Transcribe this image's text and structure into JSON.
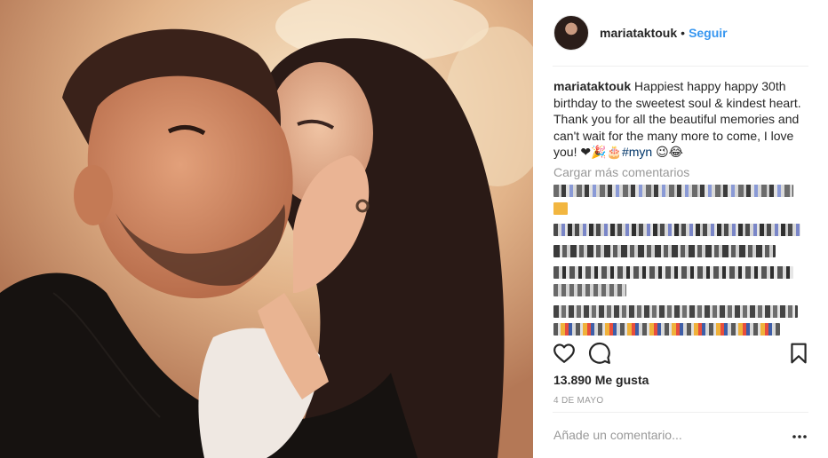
{
  "post": {
    "username": "mariataktouk",
    "separator": "•",
    "follow_label": "Seguir",
    "caption_user": "mariataktouk",
    "caption_text": "Happiest happy happy 30th birthday to the sweetest soul & kindest heart. Thank you for all the beautiful memories and can't wait for the many more to come, I love you!",
    "caption_emojis": "❤🎉🎂",
    "hashtag": "#myn",
    "caption_end_emojis": "😉😂",
    "load_more_label": "Cargar más comentarios",
    "likes": "13.890 Me gusta",
    "date": "4 DE MAYO",
    "add_comment_placeholder": "Añade un comentario...",
    "more_options_label": "..."
  },
  "icons": {
    "like": "heart-icon",
    "comment": "comment-icon",
    "save": "bookmark-icon",
    "more": "more-options-icon"
  },
  "colors": {
    "follow": "#3897f0",
    "hashtag": "#003569",
    "muted": "#999999",
    "text": "#262626",
    "divider": "#efefef"
  }
}
